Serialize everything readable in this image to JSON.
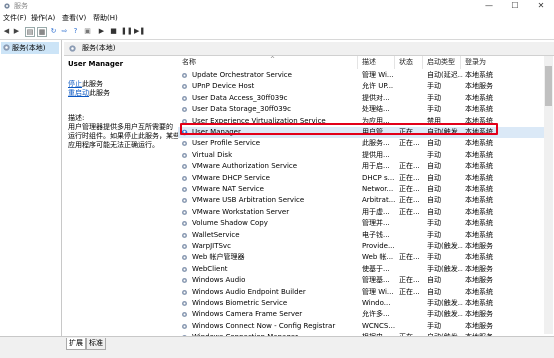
{
  "window": {
    "title": "服务"
  },
  "window_controls": {
    "minimize": "—",
    "maximize": "☐",
    "close": "✕"
  },
  "menu": [
    "文件(F)",
    "操作(A)",
    "查看(V)",
    "帮助(H)"
  ],
  "tree": {
    "selected_label": "服务(本地)"
  },
  "panel": {
    "title": "服务(本地)"
  },
  "description": {
    "service_name": "User Manager",
    "stop_link": "停止",
    "stop_suffix": "此服务",
    "restart_link": "重启动",
    "restart_suffix": "此服务",
    "desc_label": "描述:",
    "desc_lines": [
      "用户管理器提供多用户互所需要的",
      "运行时组件。如果停止此服务，某些",
      "应用程序可能无法正确运行。"
    ]
  },
  "columns": [
    "名称",
    "描述",
    "状态",
    "启动类型",
    "登录为"
  ],
  "services": [
    {
      "name": "Update Orchestrator Service",
      "desc": "管理 Wi...",
      "status": "",
      "startup": "自动(延迟...",
      "logon": "本地系统"
    },
    {
      "name": "UPnP Device Host",
      "desc": "允许 UP...",
      "status": "",
      "startup": "手动",
      "logon": "本地服务"
    },
    {
      "name": "User Data Access_30ff039c",
      "desc": "提供对...",
      "status": "",
      "startup": "手动",
      "logon": "本地系统"
    },
    {
      "name": "User Data Storage_30ff039c",
      "desc": "处理结...",
      "status": "",
      "startup": "手动",
      "logon": "本地系统"
    },
    {
      "name": "User Experience Virtualization Service",
      "desc": "为应用...",
      "status": "",
      "startup": "禁用",
      "logon": "本地系统"
    },
    {
      "name": "User Manager",
      "desc": "用户管...",
      "status": "正在...",
      "startup": "自动(触发...",
      "logon": "本地系统",
      "selected": true
    },
    {
      "name": "User Profile Service",
      "desc": "此服务...",
      "status": "正在...",
      "startup": "自动",
      "logon": "本地系统"
    },
    {
      "name": "Virtual Disk",
      "desc": "提供用...",
      "status": "",
      "startup": "手动",
      "logon": "本地系统"
    },
    {
      "name": "VMware Authorization Service",
      "desc": "用于启...",
      "status": "正在...",
      "startup": "自动",
      "logon": "本地系统"
    },
    {
      "name": "VMware DHCP Service",
      "desc": "DHCP s...",
      "status": "正在...",
      "startup": "自动",
      "logon": "本地系统"
    },
    {
      "name": "VMware NAT Service",
      "desc": "Networ...",
      "status": "正在...",
      "startup": "自动",
      "logon": "本地系统"
    },
    {
      "name": "VMware USB Arbitration Service",
      "desc": "Arbitrat...",
      "status": "正在...",
      "startup": "自动",
      "logon": "本地系统"
    },
    {
      "name": "VMware Workstation Server",
      "desc": "用于虚...",
      "status": "正在...",
      "startup": "自动",
      "logon": "本地系统"
    },
    {
      "name": "Volume Shadow Copy",
      "desc": "管理并...",
      "status": "",
      "startup": "手动",
      "logon": "本地系统"
    },
    {
      "name": "WalletService",
      "desc": "电子钱...",
      "status": "",
      "startup": "手动",
      "logon": "本地系统"
    },
    {
      "name": "WarpJITSvc",
      "desc": "Provide...",
      "status": "",
      "startup": "手动(触发...",
      "logon": "本地服务"
    },
    {
      "name": "Web 帐户管理器",
      "desc": "Web 帐...",
      "status": "正在...",
      "startup": "手动",
      "logon": "本地系统"
    },
    {
      "name": "WebClient",
      "desc": "使基于...",
      "status": "",
      "startup": "手动(触发...",
      "logon": "本地服务"
    },
    {
      "name": "Windows Audio",
      "desc": "管理基...",
      "status": "正在...",
      "startup": "自动",
      "logon": "本地服务"
    },
    {
      "name": "Windows Audio Endpoint Builder",
      "desc": "管理 Wi...",
      "status": "正在...",
      "startup": "自动",
      "logon": "本地系统"
    },
    {
      "name": "Windows Biometric Service",
      "desc": "Windo...",
      "status": "",
      "startup": "手动(触发...",
      "logon": "本地系统"
    },
    {
      "name": "Windows Camera Frame Server",
      "desc": "允许多...",
      "status": "",
      "startup": "手动(触发...",
      "logon": "本地服务"
    },
    {
      "name": "Windows Connect Now - Config Registrar",
      "desc": "WCNCS...",
      "status": "",
      "startup": "手动",
      "logon": "本地服务"
    },
    {
      "name": "Windows Connection Manager",
      "desc": "根据电...",
      "status": "正在...",
      "startup": "自动(触发...",
      "logon": "本地服务"
    }
  ],
  "tabs": [
    "扩展",
    "标准"
  ],
  "colors": {
    "selection": "#dbe9f7",
    "highlight_box": "#e2001a",
    "link": "#0a57c2"
  }
}
